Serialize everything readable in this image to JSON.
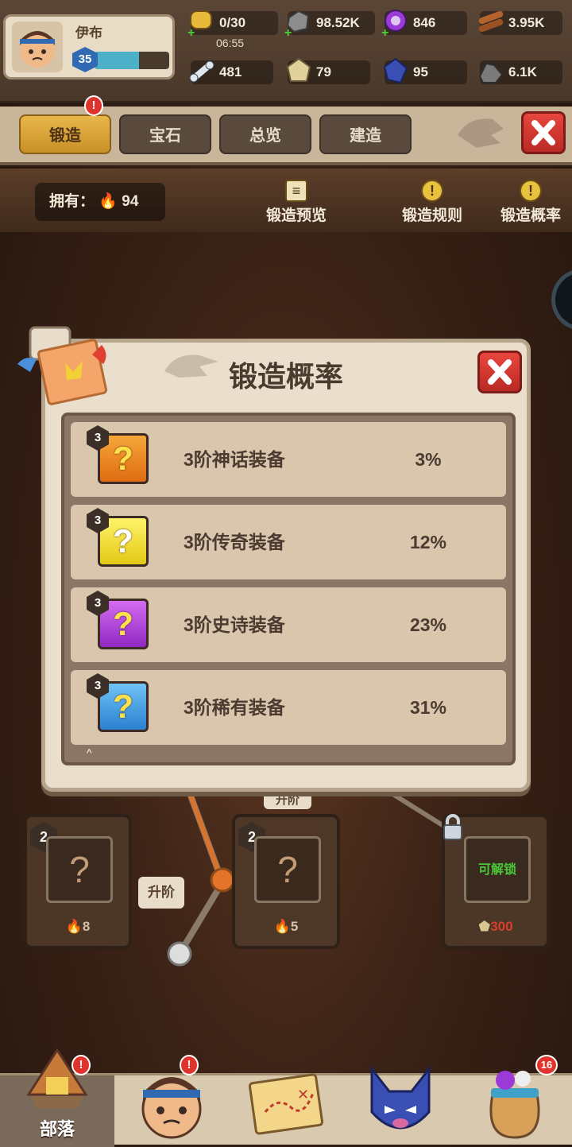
{
  "profile": {
    "name": "伊布",
    "level": "35",
    "xp_fraction": 0.6
  },
  "resources": {
    "energy": {
      "value": "0/30",
      "timer": "06:55"
    },
    "stone": "98.52K",
    "purple_gem": "846",
    "wood": "3.95K",
    "bone": "481",
    "amber": "79",
    "sapphire": "95",
    "ore": "6.1K"
  },
  "tabs": [
    {
      "label": "锻造",
      "active": true,
      "badge": "!"
    },
    {
      "label": "宝石"
    },
    {
      "label": "总览"
    },
    {
      "label": "建造"
    }
  ],
  "info": {
    "owned_label": "拥有：",
    "owned_value": "94",
    "links": [
      "锻造预览",
      "锻造规则",
      "锻造概率"
    ]
  },
  "background_nodes": [
    {
      "tier": "2",
      "cost": "8"
    },
    {
      "tier": "2",
      "cost": "5"
    },
    {
      "unlock_label": "可解锁",
      "cost": "300"
    }
  ],
  "upgrade_labels": [
    "升阶",
    "升阶"
  ],
  "modal": {
    "title": "锻造概率",
    "rows": [
      {
        "tier": "3",
        "name": "3阶神话装备",
        "percent": "3%",
        "color": "#f28a1e"
      },
      {
        "tier": "3",
        "name": "3阶传奇装备",
        "percent": "12%",
        "color": "#f4e02a"
      },
      {
        "tier": "3",
        "name": "3阶史诗装备",
        "percent": "23%",
        "color": "#b43fdc"
      },
      {
        "tier": "3",
        "name": "3阶稀有装备",
        "percent": "31%",
        "color": "#3a9be6"
      }
    ]
  },
  "bottom_nav": {
    "items": [
      {
        "label": "部落",
        "badge": "!"
      },
      {
        "badge": "!"
      },
      {},
      {},
      {
        "badge": "16"
      }
    ]
  }
}
